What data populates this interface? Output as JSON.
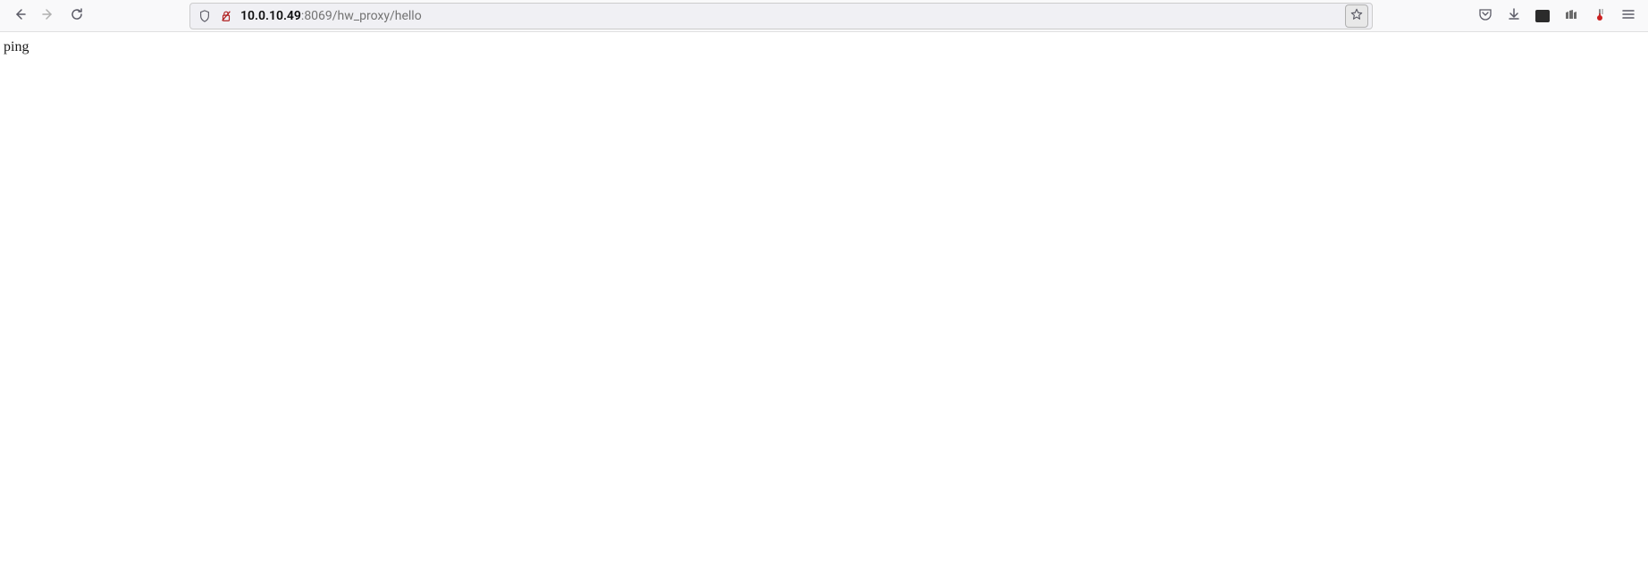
{
  "toolbar": {
    "url_host": "10.0.10.49",
    "url_path": ":8069/hw_proxy/hello"
  },
  "page": {
    "body_text": "ping"
  }
}
